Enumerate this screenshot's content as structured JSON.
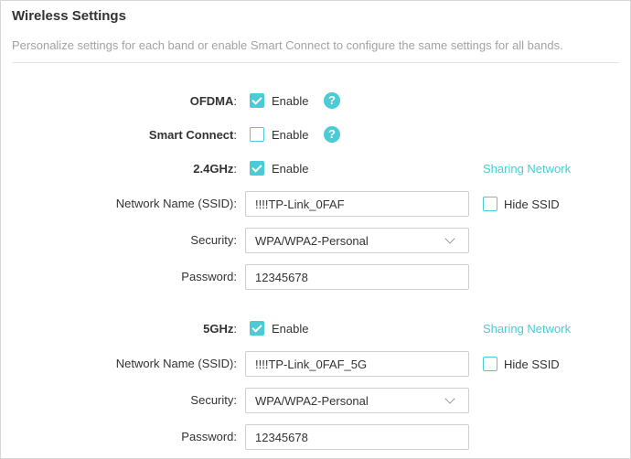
{
  "page": {
    "title": "Wireless Settings",
    "subtitle": "Personalize settings for each band or enable Smart Connect to configure the same settings for all bands."
  },
  "ofdma": {
    "label": "OFDMA",
    "colon": ":",
    "enable_label": "Enable",
    "checked": true,
    "help": "?"
  },
  "smart_connect": {
    "label": "Smart Connect",
    "colon": ":",
    "enable_label": "Enable",
    "checked": false,
    "help": "?"
  },
  "band_24": {
    "label": "2.4GHz",
    "colon": ":",
    "enable_label": "Enable",
    "checked": true,
    "sharing_link": "Sharing Network",
    "ssid_label": "Network Name (SSID):",
    "ssid_value": "!!!!TP-Link_0FAF",
    "hide_ssid_label": "Hide SSID",
    "hide_ssid_checked": false,
    "security_label": "Security:",
    "security_value": "WPA/WPA2-Personal",
    "password_label": "Password:",
    "password_value": "12345678"
  },
  "band_5": {
    "label": "5GHz",
    "colon": ":",
    "enable_label": "Enable",
    "checked": true,
    "sharing_link": "Sharing Network",
    "ssid_label": "Network Name (SSID):",
    "ssid_value": "!!!!TP-Link_0FAF_5G",
    "hide_ssid_label": "Hide SSID",
    "hide_ssid_checked": false,
    "security_label": "Security:",
    "security_value": "WPA/WPA2-Personal",
    "password_label": "Password:",
    "password_value": "12345678"
  },
  "colors": {
    "accent": "#4acbd6",
    "text": "#333333",
    "muted": "#a3a3a3",
    "border": "#cfcfcf"
  },
  "icons": {
    "help": "question-circle-icon",
    "dropdown": "chevron-down-icon",
    "check": "checkmark-icon"
  }
}
